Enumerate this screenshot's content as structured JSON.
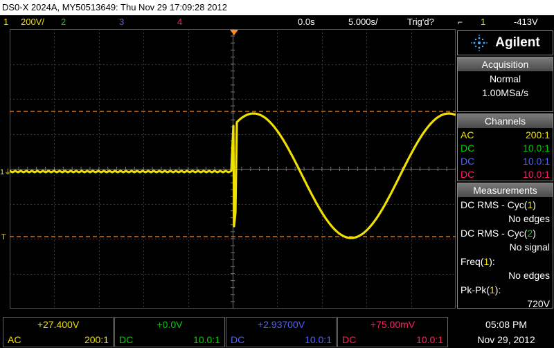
{
  "title": "DS0-X 2024A, MY50513649: Thu Nov 29 17:09:28 2012",
  "topbar": {
    "ch1_num": "1",
    "ch1_scale": "200V/",
    "ch2_num": "2",
    "ch3_num": "3",
    "ch4_num": "4",
    "time_offset": "0.0s",
    "time_scale": "5.000s/",
    "trigger_state": "Trig'd?",
    "trigger_source": "1",
    "trigger_level": "-413V"
  },
  "colors": {
    "ch1": "#f0e000",
    "ch2": "#00d000",
    "ch3": "#5060ff",
    "ch4": "#ff2060",
    "cursor": "#ff8a1a",
    "grid": "#3a3a3a"
  },
  "brand": "Agilent",
  "acquisition": {
    "header": "Acquisition",
    "mode": "Normal",
    "rate": "1.00MSa/s"
  },
  "channels": {
    "header": "Channels",
    "rows": [
      {
        "coupling": "AC",
        "probe": "200:1"
      },
      {
        "coupling": "DC",
        "probe": "10.0:1"
      },
      {
        "coupling": "DC",
        "probe": "10.0:1"
      },
      {
        "coupling": "DC",
        "probe": "10.0:1"
      }
    ]
  },
  "measurements": {
    "header": "Measurements",
    "items": [
      {
        "label_pre": "DC RMS - Cyc(",
        "src": "1",
        "label_post": ")",
        "value": "No edges"
      },
      {
        "label_pre": "DC RMS - Cyc(",
        "src": "2",
        "label_post": ")",
        "value": "No signal"
      },
      {
        "label_pre": "Freq(",
        "src": "1",
        "label_post": "):",
        "value": "No edges"
      },
      {
        "label_pre": "Pk-Pk(",
        "src": "1",
        "label_post": "):",
        "value": "720V"
      }
    ]
  },
  "markers": {
    "ch1_ground": "1",
    "trigger": "T"
  },
  "bottom_channels": [
    {
      "offset": "+27.400V",
      "coupling": "AC",
      "probe": "200:1"
    },
    {
      "offset": "+0.0V",
      "coupling": "DC",
      "probe": "10.0:1"
    },
    {
      "offset": "+2.93700V",
      "coupling": "DC",
      "probe": "10.0:1"
    },
    {
      "offset": "+75.00mV",
      "coupling": "DC",
      "probe": "10.0:1"
    }
  ],
  "clock": {
    "time": "05:08 PM",
    "date": "Nov 29, 2012"
  }
}
